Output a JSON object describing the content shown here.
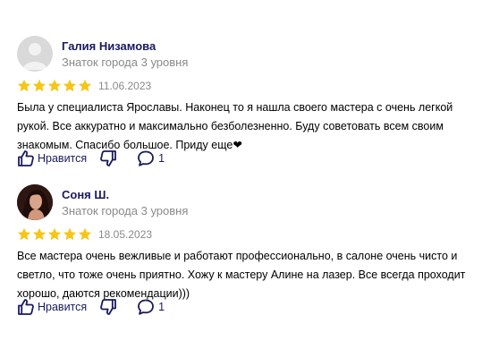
{
  "reviews": [
    {
      "author": "Галия Низамова",
      "level": "Знаток города 3 уровня",
      "rating": 5,
      "date": "11.06.2023",
      "text": "Была у специалиста Ярославы. Наконец то я нашла своего мастера с очень легкой рукой. Все аккуратно и максимально безболезненно. Буду советовать всем своим знакомым. Спасибо большое. Приду еще❤",
      "like_label": "Нравится",
      "comments_count": "1",
      "avatar": "user-placeholder"
    },
    {
      "author": "Соня Ш.",
      "level": "Знаток города 3 уровня",
      "rating": 5,
      "date": "18.05.2023",
      "text": "Все мастера очень вежливые и работают профессионально, в салоне очень чисто и светло, что тоже очень приятно. Хожу к мастеру Алине на лазер. Все всегда проходит хорошо, даются рекомендации)))",
      "like_label": "Нравится",
      "comments_count": "1",
      "avatar": "user-photo"
    }
  ],
  "colors": {
    "star": "#f5c518",
    "name": "#1a1a5e",
    "muted": "#8a8a8a"
  }
}
